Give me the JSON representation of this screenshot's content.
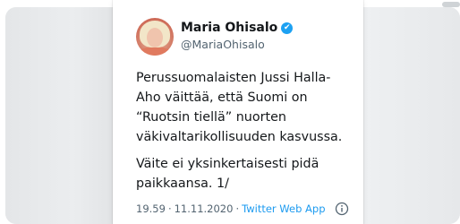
{
  "tweet": {
    "display_name": "Maria Ohisalo",
    "verified_mark": "✔",
    "handle": "@MariaOhisalo",
    "paragraph_1": "Perussuomalaisten Jussi Halla-\nAho väittää, että Suomi on\n“Ruotsin tiellä” nuorten\nväkivaltarikollisuuden kasvussa.",
    "paragraph_2": "Väite ei yksinkertaisesti pidä\npaikkaansa. 1/",
    "time": "19.59",
    "separator": "·",
    "date": "11.11.2020",
    "source": "Twitter Web App"
  },
  "icons": {
    "avatar": "profile-photo",
    "verified": "verified-badge-icon",
    "info": "info-icon"
  },
  "colors": {
    "verified_blue": "#1da1f2",
    "link_blue": "#1d9bf0",
    "secondary_text": "#536471",
    "primary_text": "#14171a"
  }
}
